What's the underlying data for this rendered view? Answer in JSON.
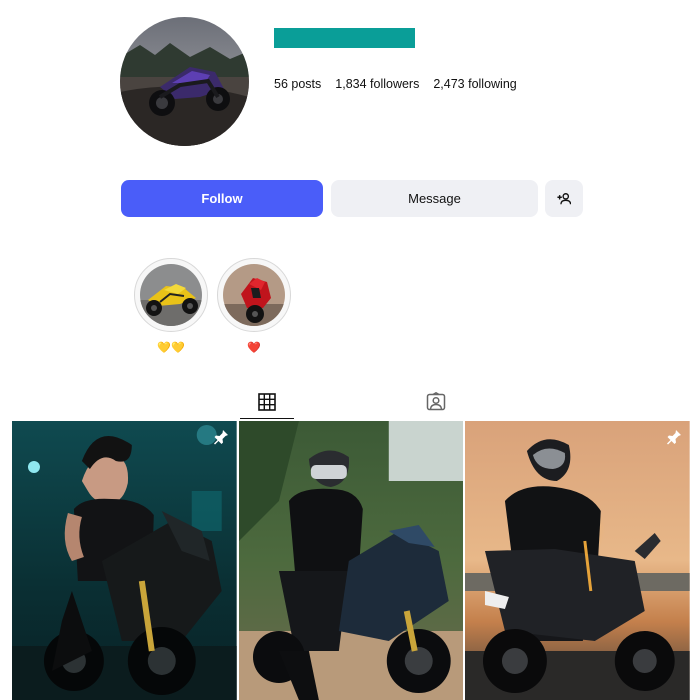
{
  "profile": {
    "stats": {
      "posts": "56 posts",
      "followers": "1,834 followers",
      "following": "2,473 following"
    },
    "username_bar_color": "#0a9e98",
    "avatar_icon": "motorcycle-photo"
  },
  "actions": {
    "follow_label": "Follow",
    "message_label": "Message",
    "suggest_icon": "add-person-icon",
    "follow_color": "#4a5df9"
  },
  "highlights": [
    {
      "label": "💛💛",
      "photo": "yellow-motorcycle"
    },
    {
      "label": "❤️",
      "photo": "red-motorcycle"
    }
  ],
  "tabs": [
    {
      "name": "posts",
      "icon": "grid-icon",
      "active": true
    },
    {
      "name": "tagged",
      "icon": "tagged-person-icon",
      "active": false
    }
  ],
  "posts": [
    {
      "photo": "rider-on-black-sportbike-rainy-night",
      "pinned": true
    },
    {
      "photo": "helmeted-rider-blue-sportbike-forest",
      "pinned": false
    },
    {
      "photo": "helmeted-rider-black-naked-bike-sunset",
      "pinned": true
    }
  ]
}
